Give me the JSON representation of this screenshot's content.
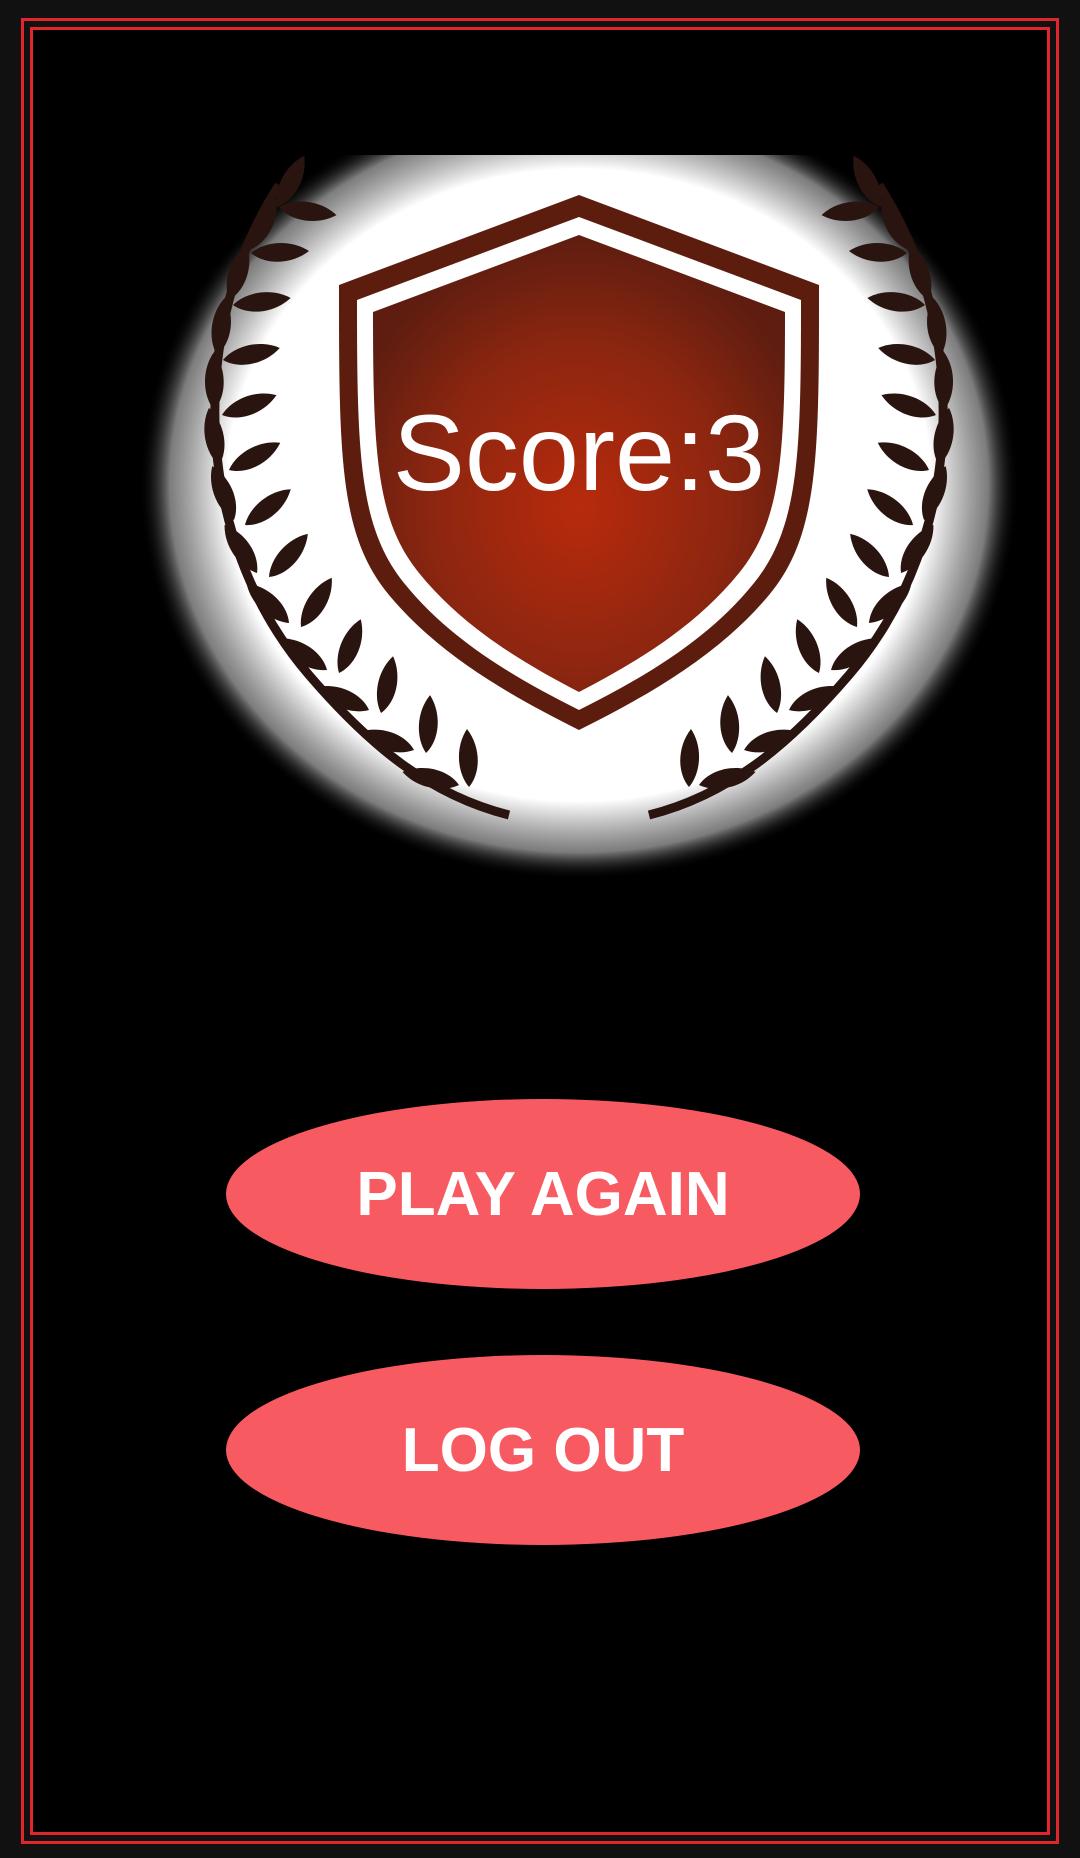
{
  "result": {
    "score_text": "Score:3",
    "score": 3
  },
  "buttons": {
    "play_again": "PLAY AGAIN",
    "log_out": "LOG OUT"
  },
  "colors": {
    "frame": "#e0262c",
    "button": "#f85a62",
    "shield": "#8e2410",
    "background": "#000000"
  },
  "icons": {
    "emblem": "laurel-shield-icon"
  }
}
